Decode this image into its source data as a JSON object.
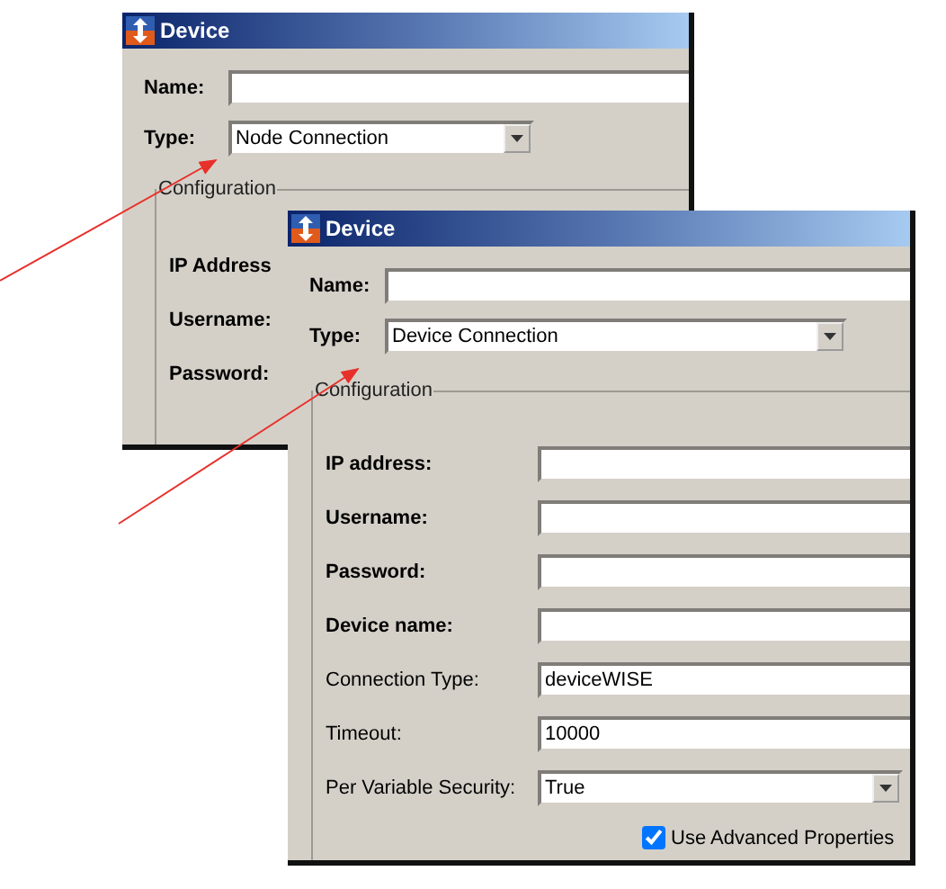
{
  "windows": [
    {
      "title": "Device",
      "fields": [
        {
          "label": "Name:",
          "kind": "text"
        },
        {
          "label": "Type:",
          "kind": "select",
          "value": "Node Connection"
        }
      ],
      "group": {
        "title": "Configuration",
        "fields": [
          {
            "label": "IP Address",
            "kind": "label",
            "emphasized": true
          },
          {
            "label": "Username:",
            "kind": "label",
            "emphasized": true
          },
          {
            "label": "Password:",
            "kind": "label",
            "emphasized": true
          }
        ]
      }
    },
    {
      "title": "Device",
      "fields": [
        {
          "label": "Name:",
          "kind": "text"
        },
        {
          "label": "Type:",
          "kind": "select",
          "value": "Device Connection"
        }
      ],
      "group": {
        "title": "Configuration",
        "fields": [
          {
            "label": "IP address:",
            "kind": "text",
            "emphasized": true
          },
          {
            "label": "Username:",
            "kind": "text",
            "emphasized": true
          },
          {
            "label": "Password:",
            "kind": "text",
            "emphasized": true
          },
          {
            "label": "Device name:",
            "kind": "text",
            "emphasized": true
          },
          {
            "label": "Connection Type:",
            "kind": "text",
            "emphasized": false,
            "value": "deviceWISE"
          },
          {
            "label": "Timeout:",
            "kind": "text",
            "emphasized": false,
            "value": "10000"
          },
          {
            "label": "Per Variable Security:",
            "kind": "select",
            "emphasized": false,
            "value": "True"
          }
        ],
        "checkbox": {
          "label": "Use Advanced Properties",
          "checked": true
        }
      }
    }
  ]
}
